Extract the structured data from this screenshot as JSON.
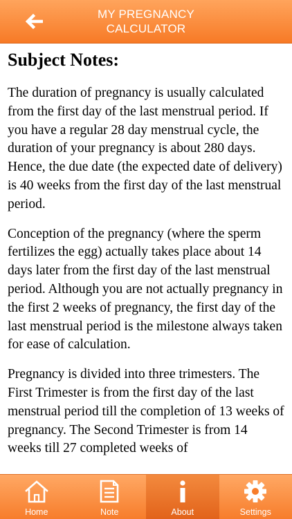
{
  "header": {
    "title_line1": "MY PREGNANCY",
    "title_line2": "CALCULATOR",
    "back_icon": "back-arrow-icon"
  },
  "content": {
    "heading": "Subject Notes:",
    "paragraphs": [
      "The duration of pregnancy is usually calculated from the first day of the last menstrual period. If you have a regular 28 day menstrual cycle, the duration of your pregnancy is about 280 days. Hence, the due date (the expected date of delivery) is 40 weeks from the first day of the last menstrual period.",
      "Conception of the pregnancy (where the sperm fertilizes the egg) actually takes place about 14 days later from the first day of the last menstrual period. Although you are not actually pregnancy in the first 2 weeks of pregnancy, the first day of the last menstrual period is the milestone always taken for ease of calculation.",
      "Pregnancy is divided into three trimesters. The First Trimester is from the first day of the last menstrual period till the completion of 13 weeks of pregnancy. The Second Trimester is from 14 weeks till 27 completed weeks of"
    ]
  },
  "tabbar": {
    "tabs": [
      {
        "label": "Home",
        "icon": "home-icon"
      },
      {
        "label": "Note",
        "icon": "note-icon"
      },
      {
        "label": "About",
        "icon": "info-icon",
        "active": true
      },
      {
        "label": "Settings",
        "icon": "gear-icon"
      }
    ]
  },
  "colors": {
    "accent": "#f77a26",
    "accent_light": "#ffa45c",
    "active_tab": "#e2631a",
    "text": "#000000"
  }
}
